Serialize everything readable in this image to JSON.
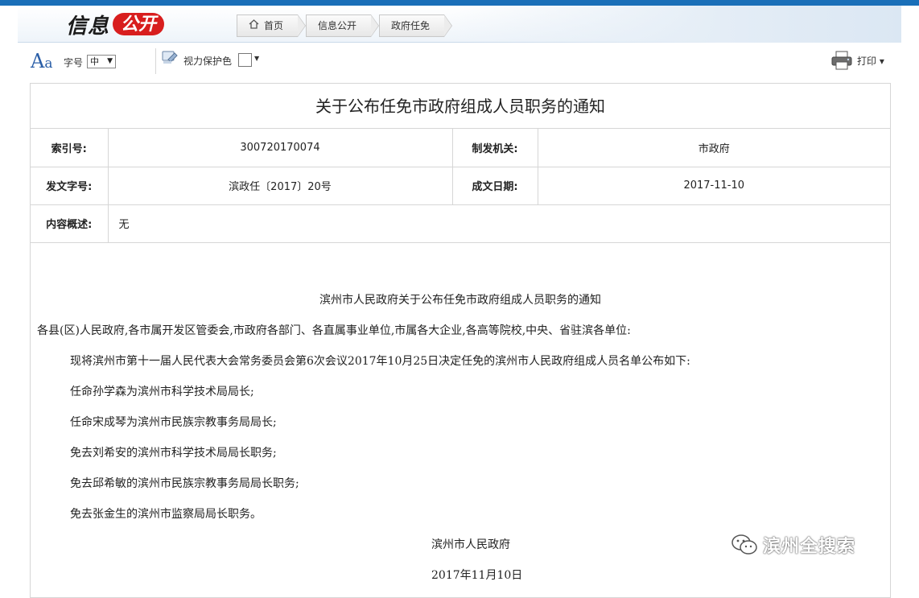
{
  "colors": {
    "top_bar": "#1a6fb8",
    "logo_red": "#d81e1e",
    "font_icon_blue": "#2b5fa8"
  },
  "header": {
    "logo_text_a": "信息",
    "logo_text_b": "公开",
    "breadcrumb": [
      "首页",
      "信息公开",
      "政府任免"
    ]
  },
  "toolbar": {
    "font_size_label": "字号",
    "font_size_value": "中",
    "eye_protect_label": "视力保护色",
    "print_label": "打印"
  },
  "document": {
    "title": "关于公布任免市政府组成人员职务的通知",
    "meta": {
      "index_label": "索引号:",
      "index_value": "300720170074",
      "issuer_label": "制发机关:",
      "issuer_value": "市政府",
      "doc_no_label": "发文字号:",
      "doc_no_value": "滨政任〔2017〕20号",
      "date_label": "成文日期:",
      "date_value": "2017-11-10",
      "summary_label": "内容概述:",
      "summary_value": "无"
    },
    "body": {
      "heading": "滨州市人民政府关于公布任免市政府组成人员职务的通知",
      "salutation": "各县(区)人民政府,各市属开发区管委会,市政府各部门、各直属事业单位,市属各大企业,各高等院校,中央、省驻滨各单位:",
      "intro": "现将滨州市第十一届人民代表大会常务委员会第6次会议2017年10月25日决定任免的滨州市人民政府组成人员名单公布如下:",
      "items": [
        "任命孙学森为滨州市科学技术局局长;",
        "任命宋成琴为滨州市民族宗教事务局局长;",
        "免去刘希安的滨州市科学技术局局长职务;",
        "免去邱希敏的滨州市民族宗教事务局局长职务;",
        "免去张金生的滨州市监察局局长职务。"
      ],
      "signature": "滨州市人民政府",
      "sign_date": "2017年11月10日"
    }
  },
  "watermark": {
    "text": "滨州全搜索",
    "icon": "wechat-icon"
  }
}
